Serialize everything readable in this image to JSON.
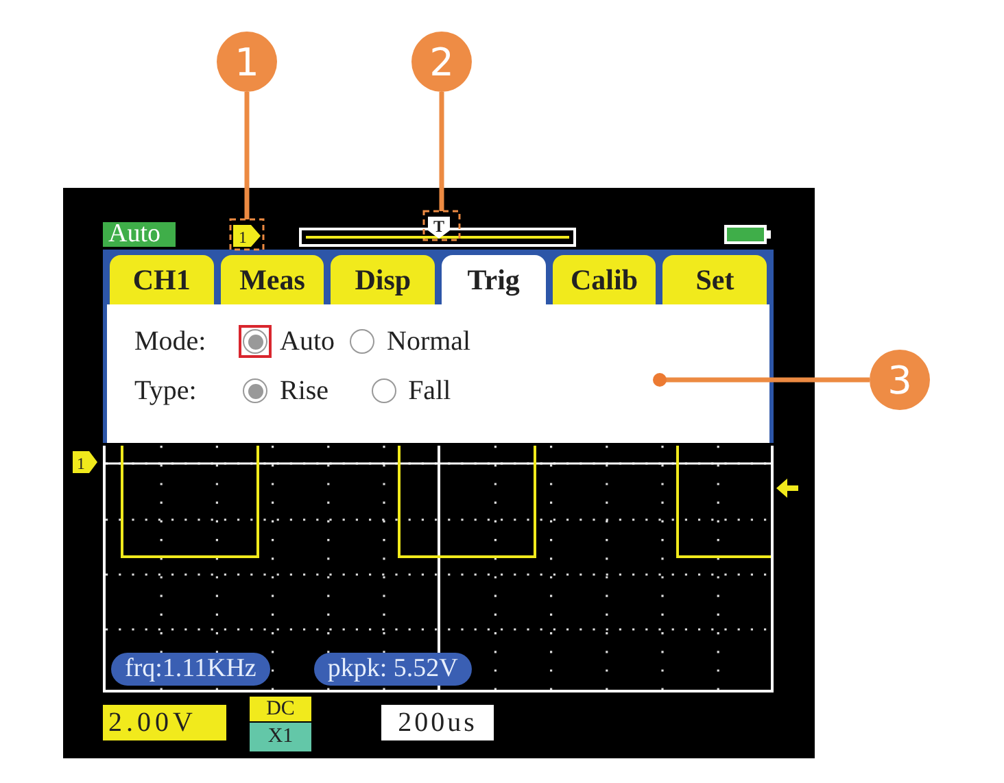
{
  "status_bar": {
    "mode": "Auto",
    "channel_marker": "1",
    "trigger_marker": "T"
  },
  "tabs": [
    {
      "label": "CH1",
      "selected": false
    },
    {
      "label": "Meas",
      "selected": false
    },
    {
      "label": "Disp",
      "selected": false
    },
    {
      "label": "Trig",
      "selected": true
    },
    {
      "label": "Calib",
      "selected": false
    },
    {
      "label": "Set",
      "selected": false
    }
  ],
  "trigger_settings": [
    {
      "label": "Mode:",
      "options": [
        {
          "label": "Auto",
          "selected": true,
          "focused": true
        },
        {
          "label": "Normal",
          "selected": false,
          "focused": false
        }
      ]
    },
    {
      "label": "Type:",
      "options": [
        {
          "label": "Rise",
          "selected": true,
          "focused": false
        },
        {
          "label": "Fall",
          "selected": false,
          "focused": false
        }
      ]
    }
  ],
  "waveform": {
    "channel_marker": "1"
  },
  "measurements": [
    "frq:1.11KHz",
    "pkpk: 5.52V"
  ],
  "bottom_bar": {
    "volts_per_div": "2.00V",
    "coupling": "DC",
    "probe": "X1",
    "time_per_div": "200us"
  },
  "callouts": [
    {
      "number": "1"
    },
    {
      "number": "2"
    },
    {
      "number": "3"
    }
  ]
}
